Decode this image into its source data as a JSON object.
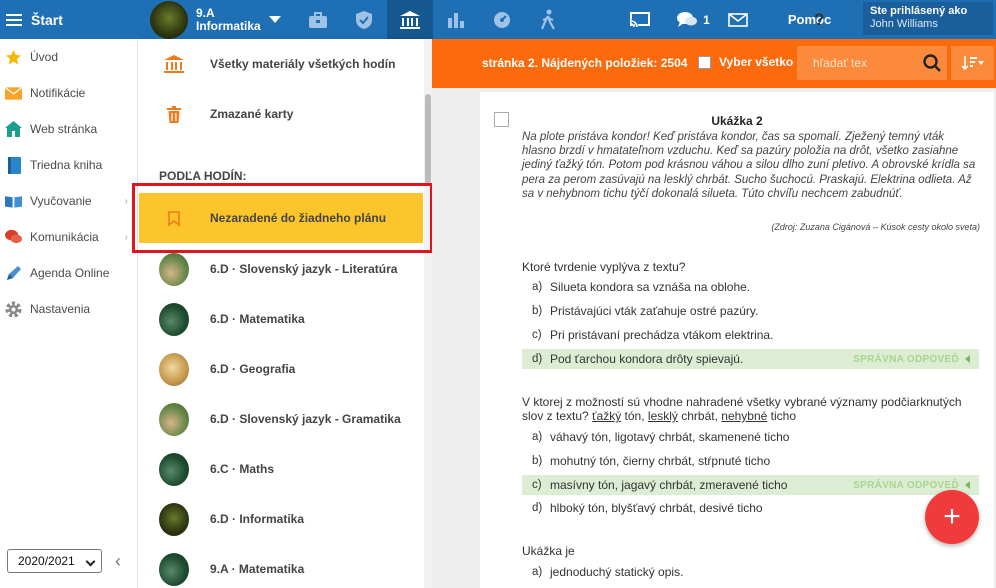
{
  "topbar": {
    "menu_label": "Štart",
    "class_line1": "9.A",
    "class_line2": "Informatika",
    "chat_count": "1",
    "help_label": "Pomoc",
    "user_caption": "Ste prihlásený ako",
    "user_name": "John Williams",
    "colors": {
      "bar": "#1f6fb5",
      "active": "#15578f"
    }
  },
  "leftnav": {
    "items": [
      {
        "label": "Úvod",
        "icon": "star-icon"
      },
      {
        "label": "Notifikácie",
        "icon": "envelope-icon"
      },
      {
        "label": "Web stránka",
        "icon": "house-icon"
      },
      {
        "label": "Triedna kniha",
        "icon": "book-icon"
      },
      {
        "label": "Vyučovanie",
        "icon": "open-book-icon"
      },
      {
        "label": "Komunikácia",
        "icon": "chat-icon"
      },
      {
        "label": "Agenda Online",
        "icon": "pen-icon"
      },
      {
        "label": "Nastavenia",
        "icon": "gear-icon"
      }
    ],
    "year": "2020/2021"
  },
  "panel": {
    "all_materials": "Všetky materiály všetkých hodín",
    "deleted_cards": "Zmazané karty",
    "section_head": "PODĽA HODÍN:",
    "unassigned": "Nezaradené do žiadneho plánu",
    "lessons": [
      "6.D · Slovenský jazyk - Literatúra",
      "6.D · Matematika",
      "6.D · Geografia",
      "6.D · Slovenský jazyk - Gramatika",
      "6.C · Maths",
      "6.D · Informatika",
      "9.A · Matematika"
    ]
  },
  "toolbar": {
    "page_info": "stránka 2. Nájdených položiek: 2504",
    "select_all": "Vyber všetko",
    "search_placeholder": "hľadať tex",
    "color": "#fb6a0c"
  },
  "card": {
    "title": "Ukážka 2",
    "passage": "Na plote pristáva kondor! Keď pristáva kondor, čas sa spomalí. Zježený temný vták hlasno brzdí v hmatateľnom vzduchu. Keď sa pazúry položia na drôt, všetko zasiahne jediný ťažký tón. Potom pod krásnou váhou a silou dlho zuní pletivo. A obrovské krídla sa pera za perom zasúvajú na lesklý chrbát. Sucho šuchocú. Praskajú. Elektrina odlieta. Až sa v nehybnom tichu týčí dokonalá silueta. Túto chvíľu nechcem zabudnúť.",
    "source": "(Zdroj: Zuzana Cigánová – Kúsok cesty okolo sveta)",
    "correct_label": "SPRÁVNA ODPOVEĎ",
    "q1": {
      "text": "Ktoré tvrdenie vyplýva z textu?",
      "options": [
        {
          "letter": "a)",
          "text": "Silueta kondora sa vznáša na oblohe."
        },
        {
          "letter": "b)",
          "text": "Pristávajúci vták zaťahuje ostré pazúry."
        },
        {
          "letter": "c)",
          "text": "Pri pristávaní prechádza vtákom elektrina."
        },
        {
          "letter": "d)",
          "text": "Pod ťarchou kondora drôty spievajú."
        }
      ]
    },
    "q2": {
      "text_before": "V ktorej z možností sú vhodne nahradené všetky vybrané významy podčiarknutých slov z textu? ",
      "w1": "ťažký",
      "t1": " tón, ",
      "w2": "lesklý",
      "t2": " chrbát, ",
      "w3": "nehybné",
      "t3": " ticho",
      "options": [
        {
          "letter": "a)",
          "text": "váhavý tón, ligotavý chrbát, skamenené ticho"
        },
        {
          "letter": "b)",
          "text": "mohutný tón, čierny chrbát, stŕpnuté ticho"
        },
        {
          "letter": "c)",
          "text": "masívny tón, jagavý chrbát, zmeravené ticho"
        },
        {
          "letter": "d)",
          "text": "hlboký tón, blyšťavý chrbát, desivé ticho"
        }
      ]
    },
    "q3": {
      "text": "Ukážka je",
      "options": [
        {
          "letter": "a)",
          "text": "jednoduchý statický opis."
        }
      ]
    }
  },
  "fab_label": "+"
}
